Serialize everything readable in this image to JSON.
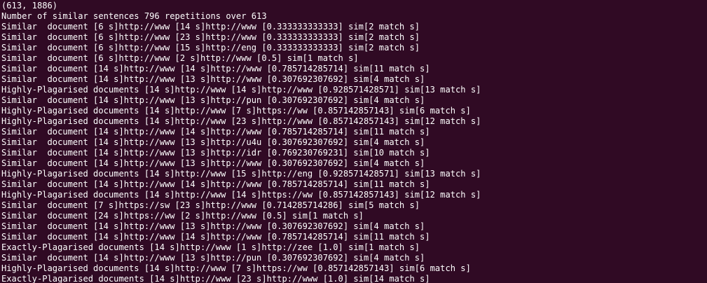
{
  "terminal": {
    "lines": [
      "(613, 1886)",
      "Number of similar sentences 796 repetitions over 613",
      "Similar  document [6 s]http://www [14 s]http://www [0.333333333333] sim[2 match s]",
      "Similar  document [6 s]http://www [23 s]http://www [0.333333333333] sim[2 match s]",
      "Similar  document [6 s]http://www [15 s]http://eng [0.333333333333] sim[2 match s]",
      "Similar  document [6 s]http://www [2 s]http://www [0.5] sim[1 match s]",
      "Similar  document [14 s]http://www [14 s]http://www [0.785714285714] sim[11 match s]",
      "Similar  document [14 s]http://www [13 s]http://www [0.307692307692] sim[4 match s]",
      "Highly-Plagarised documents [14 s]http://www [14 s]http://www [0.928571428571] sim[13 match s]",
      "Similar  document [14 s]http://www [13 s]http://pun [0.307692307692] sim[4 match s]",
      "Highly-Plagarised documents [14 s]http://www [7 s]https://ww [0.857142857143] sim[6 match s]",
      "Highly-Plagarised documents [14 s]http://www [23 s]http://www [0.857142857143] sim[12 match s]",
      "Similar  document [14 s]http://www [14 s]http://www [0.785714285714] sim[11 match s]",
      "Similar  document [14 s]http://www [13 s]http://u4u [0.307692307692] sim[4 match s]",
      "Similar  document [14 s]http://www [13 s]http://idr [0.769230769231] sim[10 match s]",
      "Similar  document [14 s]http://www [13 s]http://www [0.307692307692] sim[4 match s]",
      "Highly-Plagarised documents [14 s]http://www [15 s]http://eng [0.928571428571] sim[13 match s]",
      "Similar  document [14 s]http://www [14 s]http://www [0.785714285714] sim[11 match s]",
      "Highly-Plagarised documents [14 s]http://www [14 s]https://ww [0.857142857143] sim[12 match s]",
      "Similar  document [7 s]https://sw [23 s]http://www [0.714285714286] sim[5 match s]",
      "Similar  document [24 s]https://ww [2 s]http://www [0.5] sim[1 match s]",
      "Similar  document [14 s]http://www [13 s]http://www [0.307692307692] sim[4 match s]",
      "Similar  document [14 s]http://www [14 s]http://www [0.785714285714] sim[11 match s]",
      "Exactly-Plagarised documents [14 s]http://www [1 s]http://zee [1.0] sim[1 match s]",
      "Similar  document [14 s]http://www [13 s]http://pun [0.307692307692] sim[4 match s]",
      "Highly-Plagarised documents [14 s]http://www [7 s]https://ww [0.857142857143] sim[6 match s]",
      "Exactly-Plagarised documents [14 s]http://www [23 s]http://www [1.0] sim[14 match s]"
    ]
  }
}
